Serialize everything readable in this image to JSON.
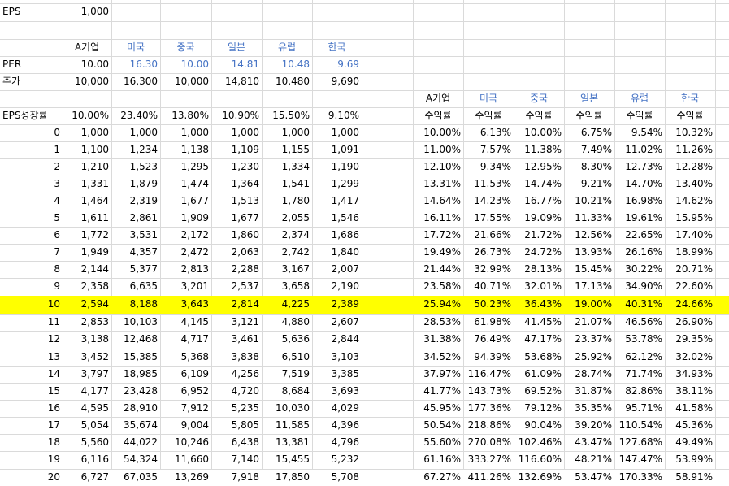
{
  "eps_label": "EPS",
  "eps_value": "1,000",
  "countries": [
    "A기업",
    "미국",
    "중국",
    "일본",
    "유럽",
    "한국"
  ],
  "per_label": "PER",
  "per_values": [
    "10.00",
    "16.30",
    "10.00",
    "14.81",
    "10.48",
    "9.69"
  ],
  "price_label": "주가",
  "price_values": [
    "10,000",
    "16,300",
    "10,000",
    "14,810",
    "10,480",
    "9,690"
  ],
  "growth_label": "EPS성장률",
  "growth_values": [
    "10.00%",
    "23.40%",
    "13.80%",
    "10.90%",
    "15.50%",
    "9.10%"
  ],
  "return_label": "수익률",
  "highlight_row_index": 10,
  "rows": [
    {
      "year": "0",
      "eps": [
        "1,000",
        "1,000",
        "1,000",
        "1,000",
        "1,000",
        "1,000"
      ],
      "ret": [
        "10.00%",
        "6.13%",
        "10.00%",
        "6.75%",
        "9.54%",
        "10.32%"
      ]
    },
    {
      "year": "1",
      "eps": [
        "1,100",
        "1,234",
        "1,138",
        "1,109",
        "1,155",
        "1,091"
      ],
      "ret": [
        "11.00%",
        "7.57%",
        "11.38%",
        "7.49%",
        "11.02%",
        "11.26%"
      ]
    },
    {
      "year": "2",
      "eps": [
        "1,210",
        "1,523",
        "1,295",
        "1,230",
        "1,334",
        "1,190"
      ],
      "ret": [
        "12.10%",
        "9.34%",
        "12.95%",
        "8.30%",
        "12.73%",
        "12.28%"
      ]
    },
    {
      "year": "3",
      "eps": [
        "1,331",
        "1,879",
        "1,474",
        "1,364",
        "1,541",
        "1,299"
      ],
      "ret": [
        "13.31%",
        "11.53%",
        "14.74%",
        "9.21%",
        "14.70%",
        "13.40%"
      ]
    },
    {
      "year": "4",
      "eps": [
        "1,464",
        "2,319",
        "1,677",
        "1,513",
        "1,780",
        "1,417"
      ],
      "ret": [
        "14.64%",
        "14.23%",
        "16.77%",
        "10.21%",
        "16.98%",
        "14.62%"
      ]
    },
    {
      "year": "5",
      "eps": [
        "1,611",
        "2,861",
        "1,909",
        "1,677",
        "2,055",
        "1,546"
      ],
      "ret": [
        "16.11%",
        "17.55%",
        "19.09%",
        "11.33%",
        "19.61%",
        "15.95%"
      ]
    },
    {
      "year": "6",
      "eps": [
        "1,772",
        "3,531",
        "2,172",
        "1,860",
        "2,374",
        "1,686"
      ],
      "ret": [
        "17.72%",
        "21.66%",
        "21.72%",
        "12.56%",
        "22.65%",
        "17.40%"
      ]
    },
    {
      "year": "7",
      "eps": [
        "1,949",
        "4,357",
        "2,472",
        "2,063",
        "2,742",
        "1,840"
      ],
      "ret": [
        "19.49%",
        "26.73%",
        "24.72%",
        "13.93%",
        "26.16%",
        "18.99%"
      ]
    },
    {
      "year": "8",
      "eps": [
        "2,144",
        "5,377",
        "2,813",
        "2,288",
        "3,167",
        "2,007"
      ],
      "ret": [
        "21.44%",
        "32.99%",
        "28.13%",
        "15.45%",
        "30.22%",
        "20.71%"
      ]
    },
    {
      "year": "9",
      "eps": [
        "2,358",
        "6,635",
        "3,201",
        "2,537",
        "3,658",
        "2,190"
      ],
      "ret": [
        "23.58%",
        "40.71%",
        "32.01%",
        "17.13%",
        "34.90%",
        "22.60%"
      ]
    },
    {
      "year": "10",
      "eps": [
        "2,594",
        "8,188",
        "3,643",
        "2,814",
        "4,225",
        "2,389"
      ],
      "ret": [
        "25.94%",
        "50.23%",
        "36.43%",
        "19.00%",
        "40.31%",
        "24.66%"
      ]
    },
    {
      "year": "11",
      "eps": [
        "2,853",
        "10,103",
        "4,145",
        "3,121",
        "4,880",
        "2,607"
      ],
      "ret": [
        "28.53%",
        "61.98%",
        "41.45%",
        "21.07%",
        "46.56%",
        "26.90%"
      ]
    },
    {
      "year": "12",
      "eps": [
        "3,138",
        "12,468",
        "4,717",
        "3,461",
        "5,636",
        "2,844"
      ],
      "ret": [
        "31.38%",
        "76.49%",
        "47.17%",
        "23.37%",
        "53.78%",
        "29.35%"
      ]
    },
    {
      "year": "13",
      "eps": [
        "3,452",
        "15,385",
        "5,368",
        "3,838",
        "6,510",
        "3,103"
      ],
      "ret": [
        "34.52%",
        "94.39%",
        "53.68%",
        "25.92%",
        "62.12%",
        "32.02%"
      ]
    },
    {
      "year": "14",
      "eps": [
        "3,797",
        "18,985",
        "6,109",
        "4,256",
        "7,519",
        "3,385"
      ],
      "ret": [
        "37.97%",
        "116.47%",
        "61.09%",
        "28.74%",
        "71.74%",
        "34.93%"
      ]
    },
    {
      "year": "15",
      "eps": [
        "4,177",
        "23,428",
        "6,952",
        "4,720",
        "8,684",
        "3,693"
      ],
      "ret": [
        "41.77%",
        "143.73%",
        "69.52%",
        "31.87%",
        "82.86%",
        "38.11%"
      ]
    },
    {
      "year": "16",
      "eps": [
        "4,595",
        "28,910",
        "7,912",
        "5,235",
        "10,030",
        "4,029"
      ],
      "ret": [
        "45.95%",
        "177.36%",
        "79.12%",
        "35.35%",
        "95.71%",
        "41.58%"
      ]
    },
    {
      "year": "17",
      "eps": [
        "5,054",
        "35,674",
        "9,004",
        "5,805",
        "11,585",
        "4,396"
      ],
      "ret": [
        "50.54%",
        "218.86%",
        "90.04%",
        "39.20%",
        "110.54%",
        "45.36%"
      ]
    },
    {
      "year": "18",
      "eps": [
        "5,560",
        "44,022",
        "10,246",
        "6,438",
        "13,381",
        "4,796"
      ],
      "ret": [
        "55.60%",
        "270.08%",
        "102.46%",
        "43.47%",
        "127.68%",
        "49.49%"
      ]
    },
    {
      "year": "19",
      "eps": [
        "6,116",
        "54,324",
        "11,660",
        "7,140",
        "15,455",
        "5,232"
      ],
      "ret": [
        "61.16%",
        "333.27%",
        "116.60%",
        "48.21%",
        "147.47%",
        "53.99%"
      ]
    },
    {
      "year": "20",
      "eps": [
        "6,727",
        "67,035",
        "13,269",
        "7,918",
        "17,850",
        "5,708"
      ],
      "ret": [
        "67.27%",
        "411.26%",
        "132.69%",
        "53.47%",
        "170.33%",
        "58.91%"
      ]
    }
  ]
}
